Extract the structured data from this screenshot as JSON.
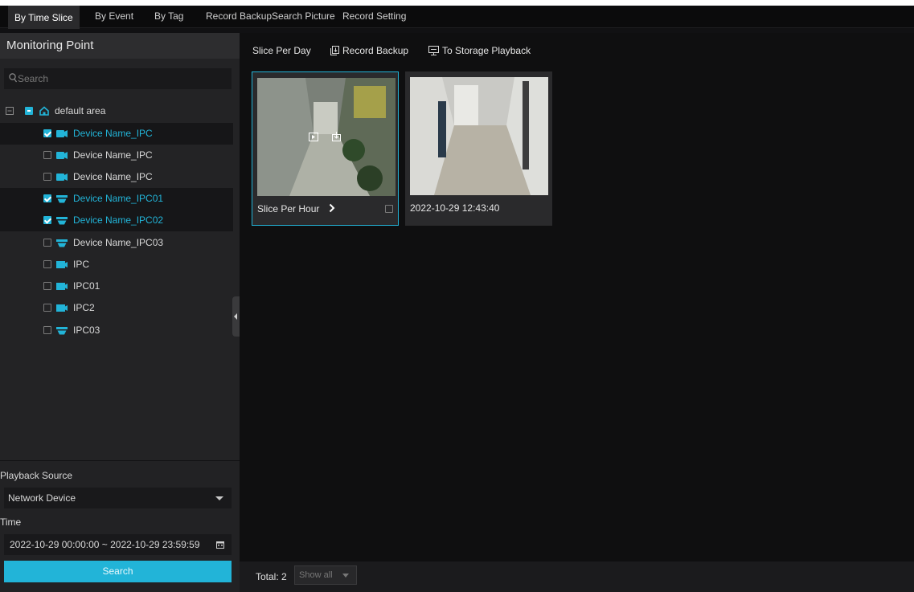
{
  "tabs": [
    {
      "label": "By Time Slice",
      "active": true
    },
    {
      "label": "By Event",
      "active": false
    },
    {
      "label": "By Tag",
      "active": false
    },
    {
      "label": "Record Backup",
      "active": false
    },
    {
      "label": "Search Picture",
      "active": false
    },
    {
      "label": "Record Setting",
      "active": false
    }
  ],
  "sidebar": {
    "title": "Monitoring Point",
    "search_placeholder": "Search",
    "root": {
      "label": "default area",
      "icon": "home-icon"
    },
    "devices": [
      {
        "label": "Device Name_IPC",
        "icon": "bullet-camera-icon",
        "checked": true,
        "selected": true
      },
      {
        "label": "Device Name_IPC",
        "icon": "bullet-camera-icon",
        "checked": false,
        "selected": false
      },
      {
        "label": "Device Name_IPC",
        "icon": "bullet-camera-icon",
        "checked": false,
        "selected": false
      },
      {
        "label": "Device Name_IPC01",
        "icon": "dome-camera-icon",
        "checked": true,
        "selected": true
      },
      {
        "label": "Device Name_IPC02",
        "icon": "dome-camera-icon",
        "checked": true,
        "selected": true
      },
      {
        "label": "Device Name_IPC03",
        "icon": "dome-camera-icon",
        "checked": false,
        "selected": false
      },
      {
        "label": "IPC",
        "icon": "box-camera-icon",
        "checked": false,
        "selected": false
      },
      {
        "label": "IPC01",
        "icon": "box-camera-icon",
        "checked": false,
        "selected": false
      },
      {
        "label": "IPC2",
        "icon": "box-camera-icon",
        "checked": false,
        "selected": false
      },
      {
        "label": "IPC03",
        "icon": "dome-camera-icon",
        "checked": false,
        "selected": false
      }
    ]
  },
  "filters": {
    "source_label": "Playback Source",
    "source_value": "Network Device",
    "time_label": "Time",
    "time_value": "2022-10-29 00:00:00 ~ 2022-10-29 23:59:59",
    "search_button": "Search"
  },
  "toolbar": {
    "slice_per_day": "Slice Per Day",
    "record_backup": "Record Backup",
    "to_storage_playback": "To Storage Playback"
  },
  "cards": [
    {
      "label": "Slice Per Hour",
      "has_arrow": true,
      "selected": true
    },
    {
      "label": "2022-10-29 12:43:40",
      "has_arrow": false,
      "selected": false
    }
  ],
  "footer": {
    "total": "Total: 2",
    "show_all": "Show all"
  },
  "colors": {
    "accent": "#22b4d8",
    "background": "#111113",
    "panel": "#232325"
  }
}
